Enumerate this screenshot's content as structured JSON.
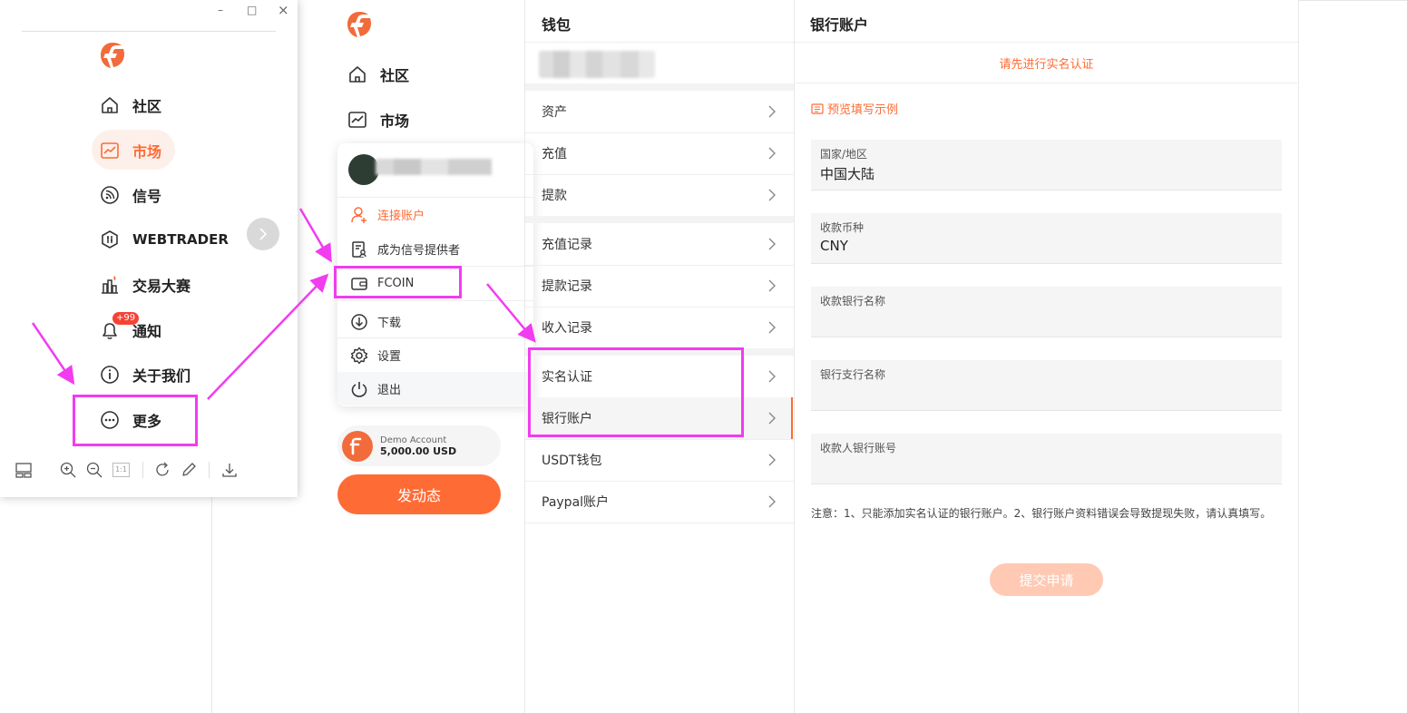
{
  "app": {
    "accent": "#ff6b35",
    "annotation_color": "#f13cf0"
  },
  "nav": {
    "community": "社区",
    "market": "市场"
  },
  "profile_menu": {
    "connect_account": "连接账户",
    "become_provider": "成为信号提供者",
    "fcoin": "FCOIN",
    "download": "下载",
    "settings": "设置",
    "logout": "退出"
  },
  "demo_account": {
    "label": "Demo Account",
    "balance": "5,000.00 USD"
  },
  "post_button": "发动态",
  "wallet": {
    "title": "钱包",
    "items": [
      {
        "label": "资产"
      },
      {
        "label": "充值"
      },
      {
        "label": "提款"
      },
      {
        "label": "充值记录"
      },
      {
        "label": "提款记录"
      },
      {
        "label": "收入记录"
      },
      {
        "label": "实名认证"
      },
      {
        "label": "银行账户"
      },
      {
        "label": "USDT钱包"
      },
      {
        "label": "Paypal账户"
      }
    ]
  },
  "bank": {
    "title": "银行账户",
    "banner": "请先进行实名认证",
    "preview_link": "预览填写示例",
    "fields": [
      {
        "label": "国家/地区",
        "value": "中国大陆"
      },
      {
        "label": "收款币种",
        "value": "CNY"
      },
      {
        "label": "收款银行名称",
        "value": ""
      },
      {
        "label": "银行支行名称",
        "value": ""
      },
      {
        "label": "收款人银行账号",
        "value": ""
      }
    ],
    "note": "注意：1、只能添加实名认证的银行账户。2、银行账户资料错误会导致提现失败，请认真填写。",
    "submit": "提交申请"
  },
  "floating_window": {
    "nav": {
      "community": "社区",
      "market": "市场",
      "signal": "信号",
      "webtrader": "WEBTRADER",
      "contest": "交易大赛",
      "notify": "通知",
      "notify_badge": "+99",
      "about": "关于我们",
      "more": "更多"
    },
    "controls": {
      "minimize": "–",
      "maximize": "□",
      "close": "×"
    },
    "zoom_reset": "1:1"
  }
}
